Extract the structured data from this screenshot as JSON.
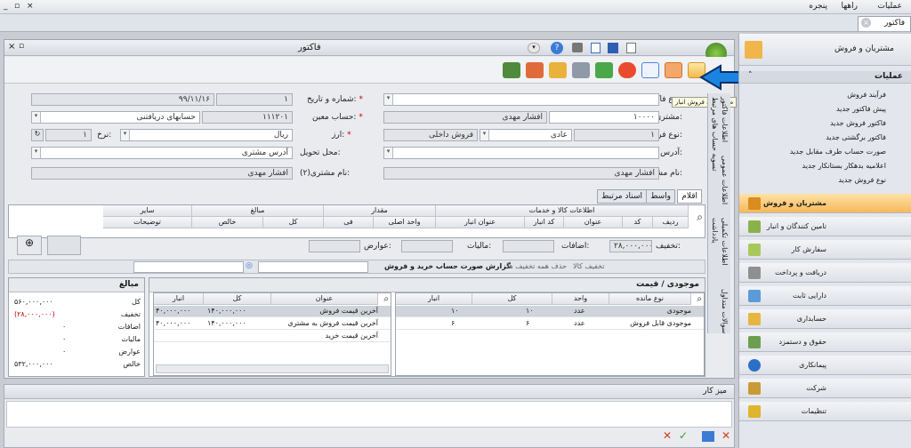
{
  "menubar": {
    "items": [
      "عملیات",
      "راهها",
      "پنجره"
    ],
    "window_controls": [
      "_",
      "▫",
      "×"
    ]
  },
  "doc_tab": {
    "label": "فاکتور"
  },
  "form": {
    "title": "فاکتور",
    "fields": {
      "invoice_type_label": "نوع فاکتور:",
      "number_date_label": "شماره و تاریخ:",
      "number": "۱",
      "date": "۹۹/۱۱/۱۶",
      "customer_label": "مشتری:",
      "customer_code": "۱۰۰۰۰",
      "customer_name": "افشار مهدی",
      "account_label": "حساب معین:",
      "account_code": "۱۱۱۲۰۱",
      "account_name": "حسابهای دریافتنی",
      "sale_type_label": "نوع فروش:",
      "sale_type_code": "۱",
      "sale_type_name": "عادی",
      "sale_kind": "فروش داخلی",
      "currency_label": "ارز:",
      "currency": "ریال",
      "rate_label": "نرخ:",
      "rate": "۱",
      "address_label": "آدرس:",
      "delivery_label": "محل تحویل:",
      "delivery_placeholder": "آدرس مشتری",
      "customer_name_label": "نام مشتری:",
      "customer_name_value": "افشار مهدی",
      "customer2_label": "نام مشتری(۲):",
      "customer2_value": "افشار مهدی"
    },
    "tooltip": "صدور سند فروش انبار"
  },
  "side_tabs": [
    "اطلاعات فاکتور",
    "اطلاعات عمومی",
    "اطلاعات تکمیلی",
    "یادداشت",
    "سوالات متداول",
    "تسویه حساب های مرتبط"
  ],
  "grid_tabs": [
    "اقلام",
    "واسط",
    "اسناد مرتبط"
  ],
  "grid": {
    "group_headers": [
      "اطلاعات کالا و خدمات",
      "مقدار",
      "مبالغ",
      "سایر"
    ],
    "columns": [
      "ردیف",
      "کد",
      "عنوان",
      "کد انبار",
      "عنوان انبار",
      "واحد اصلی",
      "فی",
      "کل",
      "خالص",
      "توضیحات"
    ]
  },
  "totals_bar": {
    "discount_label": "تخفیف:",
    "discount": "۲۸,۰۰۰,۰۰۰",
    "additions_label": "اضافات:",
    "tax_label": "مالیات:",
    "duties_label": "عوارض:"
  },
  "action_bar": {
    "report": "گزارش صورت حساب خرید و فروش",
    "remove_all_discount": "حذف همه تخفیف ها",
    "discount": "تخفیف کالا"
  },
  "stock_panel": {
    "title": "موجودی / قیمت",
    "columns": [
      "نوع مانده",
      "واحد",
      "کل",
      "انبار"
    ],
    "rows": [
      {
        "type": "موجودی",
        "unit": "عدد",
        "total": "۱۰",
        "store": "۱۰"
      },
      {
        "type": "موجودی قابل فروش",
        "unit": "عدد",
        "total": "۶",
        "store": "۶"
      }
    ]
  },
  "price_panel": {
    "columns": [
      "عنوان",
      "کل",
      "انبار"
    ],
    "rows": [
      {
        "title": "آخرین قیمت فروش",
        "total": "۱۴۰,۰۰۰,۰۰۰",
        "store": "۴۰,۰۰۰,۰۰۰"
      },
      {
        "title": "آخرین قیمت فروش به مشتری",
        "total": "۱۴۰,۰۰۰,۰۰۰",
        "store": "۴۰,۰۰۰,۰۰۰"
      },
      {
        "title": "آخرین قیمت خرید",
        "total": "",
        "store": ""
      }
    ]
  },
  "amounts_panel": {
    "title": "مبالغ",
    "rows": [
      {
        "label": "کل",
        "value": "۵۶۰,۰۰۰,۰۰۰"
      },
      {
        "label": "تخفیف",
        "value": "(۲۸,۰۰۰,۰۰۰)"
      },
      {
        "label": "اضافات",
        "value": "۰"
      },
      {
        "label": "مالیات",
        "value": "۰"
      },
      {
        "label": "عوارض",
        "value": "۰"
      },
      {
        "label": "خالص",
        "value": "۵۳۲,۰۰۰,۰۰۰"
      }
    ]
  },
  "desk": {
    "title": "میز کار"
  },
  "right_panel": {
    "title": "مشتریان و فروش",
    "ops_title": "عملیات",
    "ops": [
      "فرآیند فروش",
      "پیش فاکتور جدید",
      "فاکتور فروش جدید",
      "فاکتور برگشتی جدید",
      "صورت حساب طرف مقابل جدید",
      "اعلامیه بدهکار بستانکار جدید",
      "نوع فروش جدید"
    ],
    "modules": [
      "مشتریان و فروش",
      "تامین کنندگان و انبار",
      "سفارش کار",
      "دریافت و پرداخت",
      "دارایی ثابت",
      "حسابداری",
      "حقوق و دستمزد",
      "پیمانکاری",
      "شرکت",
      "تنظیمات"
    ]
  },
  "colors": {
    "accent": "#1e6fd9",
    "highlight": "#f7c560",
    "red": "#c00000",
    "arrow": "#1b84e0"
  }
}
